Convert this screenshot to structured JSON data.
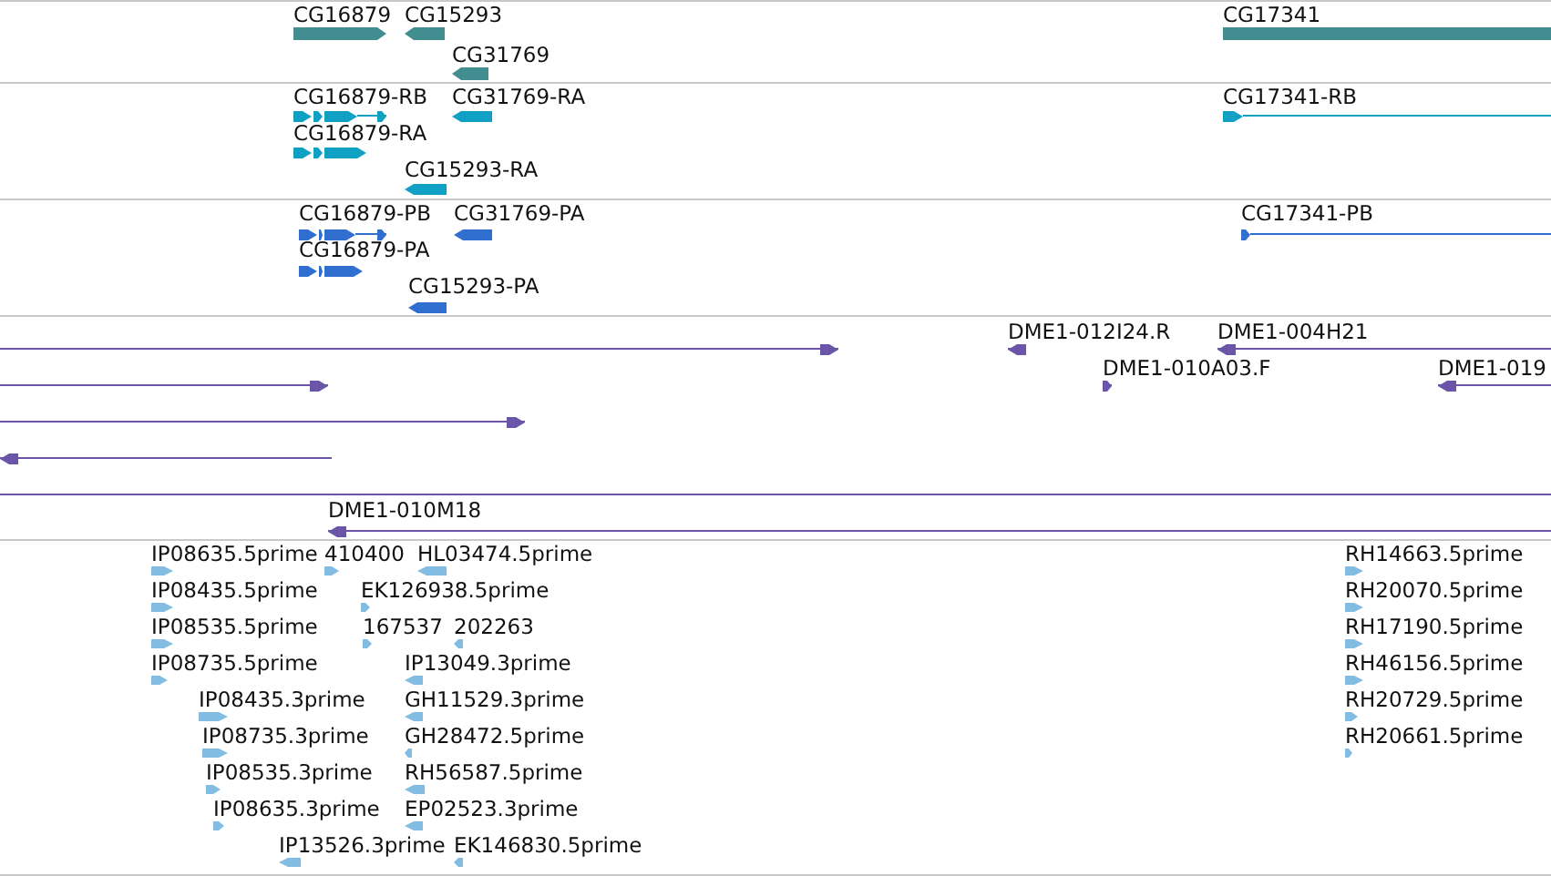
{
  "tracks": [
    {
      "kind": "gene",
      "color": "#418d8f",
      "features": [
        {
          "label": "CG16879",
          "forward": true
        },
        {
          "label": "CG15293",
          "forward": false
        },
        {
          "label": "CG17341"
        },
        {
          "label": "CG31769",
          "forward": false
        }
      ]
    },
    {
      "kind": "transcript",
      "color": "#0fa0c4",
      "features": [
        {
          "label": "CG16879-RB",
          "forward": true
        },
        {
          "label": "CG31769-RA",
          "forward": false
        },
        {
          "label": "CG17341-RB",
          "forward": true
        },
        {
          "label": "CG16879-RA",
          "forward": true
        },
        {
          "label": "CG15293-RA",
          "forward": false
        }
      ]
    },
    {
      "kind": "transcript",
      "color": "#306fd0",
      "features": [
        {
          "label": "CG16879-PB",
          "forward": true
        },
        {
          "label": "CG31769-PA",
          "forward": false
        },
        {
          "label": "CG17341-PB",
          "forward": true
        },
        {
          "label": "CG16879-PA",
          "forward": true
        },
        {
          "label": "CG15293-PA",
          "forward": false
        }
      ]
    },
    {
      "kind": "clone",
      "color": "#6a55a8",
      "features": [
        {
          "directed": true,
          "forward": true
        },
        {
          "label": "DME1-012I24.R",
          "directed": true,
          "forward": false
        },
        {
          "label": "DME1-004H21",
          "directed": true,
          "forward": false
        },
        {
          "directed": true,
          "forward": true
        },
        {
          "label": "DME1-010A03.F",
          "directed": true,
          "forward": true
        },
        {
          "label": "DME1-019",
          "directed": true,
          "forward": false
        },
        {
          "directed": true,
          "forward": true
        },
        {
          "directed": true,
          "forward": false
        },
        {
          "directed": false
        },
        {
          "label": "DME1-010M18",
          "directed": true,
          "forward": false
        }
      ]
    },
    {
      "kind": "est",
      "color": "#82bce2",
      "features": [
        {
          "label": "IP08635.5prime",
          "forward": true
        },
        {
          "label": "410400",
          "forward": true
        },
        {
          "label": "HL03474.5prime",
          "forward": false
        },
        {
          "label": "RH14663.5prime",
          "forward": true
        },
        {
          "label": "IP08435.5prime",
          "forward": true
        },
        {
          "label": "EK126938.5prime",
          "forward": true
        },
        {
          "label": "RH20070.5prime",
          "forward": true
        },
        {
          "label": "IP08535.5prime",
          "forward": true
        },
        {
          "label": "167537",
          "forward": true
        },
        {
          "label": "202263",
          "forward": false
        },
        {
          "label": "RH17190.5prime",
          "forward": true
        },
        {
          "label": "IP08735.5prime",
          "forward": true
        },
        {
          "label": "IP13049.3prime",
          "forward": false
        },
        {
          "label": "RH46156.5prime",
          "forward": true
        },
        {
          "label": "IP08435.3prime",
          "forward": true
        },
        {
          "label": "GH11529.3prime",
          "forward": false
        },
        {
          "label": "RH20729.5prime",
          "forward": true
        },
        {
          "label": "IP08735.3prime",
          "forward": true
        },
        {
          "label": "GH28472.5prime",
          "forward": false
        },
        {
          "label": "RH20661.5prime",
          "forward": true
        },
        {
          "label": "IP08535.3prime",
          "forward": true
        },
        {
          "label": "RH56587.5prime",
          "forward": false
        },
        {
          "label": "IP08635.3prime",
          "forward": true
        },
        {
          "label": "EP02523.3prime",
          "forward": false
        },
        {
          "label": "IP13526.3prime",
          "forward": false
        },
        {
          "label": "EK146830.5prime",
          "forward": false
        }
      ]
    }
  ]
}
